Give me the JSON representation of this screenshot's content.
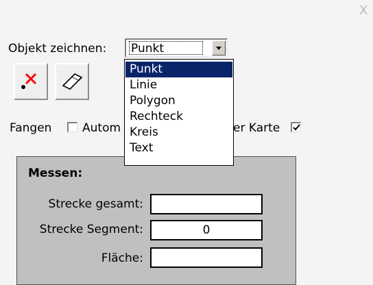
{
  "window": {
    "close_glyph": "X"
  },
  "draw": {
    "label": "Objekt zeichnen:",
    "selected": "Punkt",
    "options": [
      "Punkt",
      "Linie",
      "Polygon",
      "Rechteck",
      "Kreis",
      "Text"
    ]
  },
  "tools": {
    "delete_point_icon": "point-delete-icon",
    "eraser_icon": "eraser-icon",
    "accent_red": "#ff0000"
  },
  "options_row": {
    "snap_label": "Fangen",
    "snap_checked": false,
    "auto_label_visible_part": "Autom",
    "map_label_visible_part": "er Karte",
    "map_checked": true
  },
  "measure": {
    "title": "Messen:",
    "total_label": "Strecke gesamt:",
    "total_value": "",
    "segment_label": "Strecke Segment:",
    "segment_value": "0",
    "area_label": "Fläche:",
    "area_value": ""
  },
  "colors": {
    "dialog_bg": "#f4f4f4",
    "panel_bg": "#c0c0c0",
    "selection": "#0a246a"
  }
}
